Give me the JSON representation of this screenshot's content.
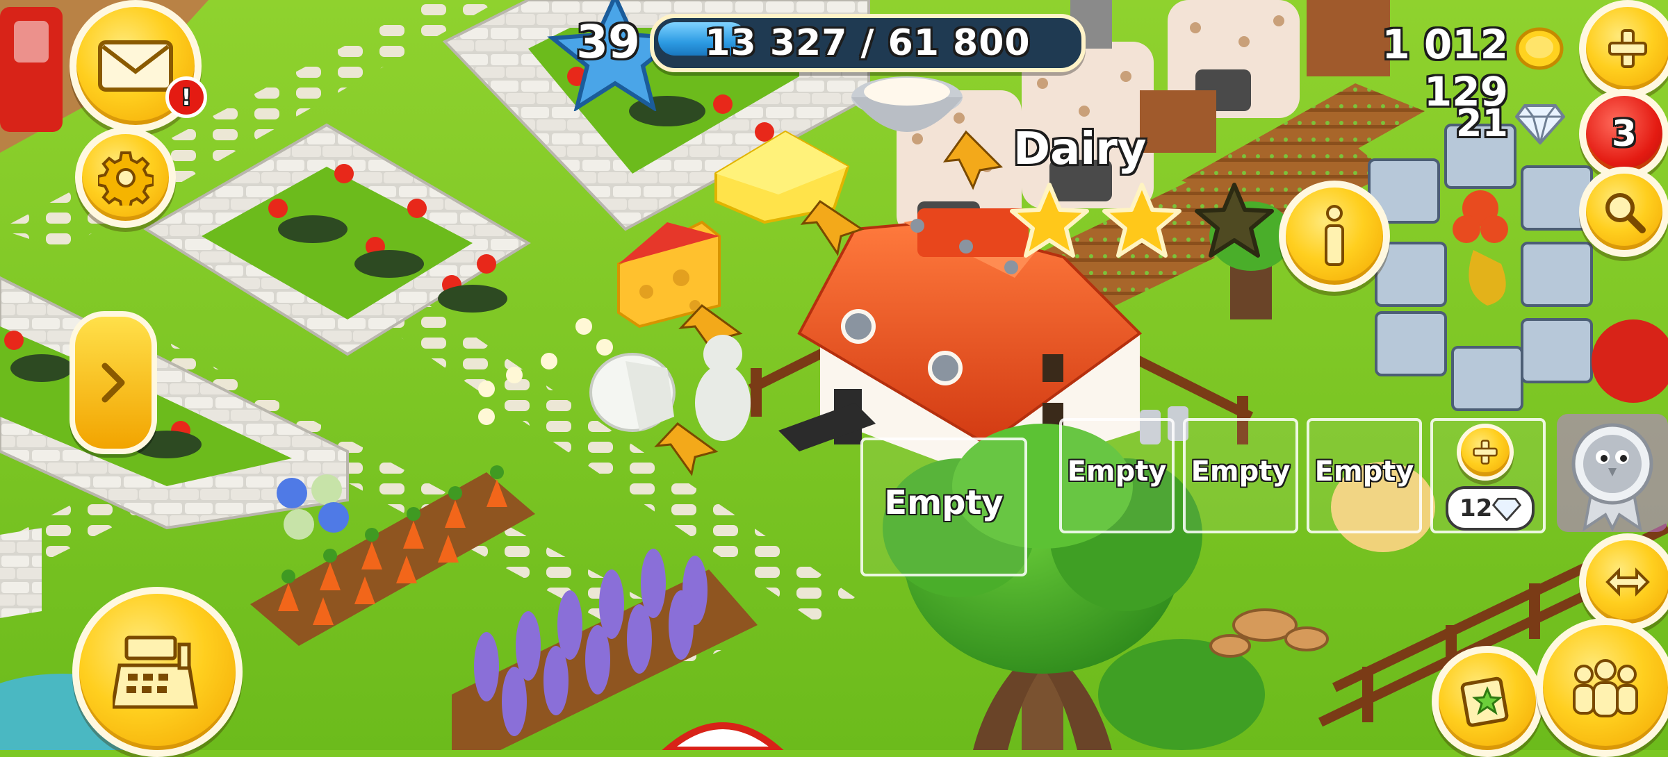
{
  "hud": {
    "level": "39",
    "xp_text": "13 327 / 61 800",
    "xp_progress": 0.216,
    "coins": "1 012 129",
    "diamonds": "21",
    "notification_count": "3",
    "mail_alert": "!"
  },
  "building": {
    "title": "Dairy",
    "stars_earned": 2,
    "stars_total": 3,
    "queue_slots": [
      {
        "label": "Empty"
      },
      {
        "label": "Empty"
      },
      {
        "label": "Empty"
      },
      {
        "label": "Empty"
      }
    ],
    "add_slot_cost": "12",
    "products": [
      "butter",
      "cheese",
      "cream",
      "goat cheese"
    ]
  },
  "icons": {
    "mail": "mail-icon",
    "settings": "gear-icon",
    "expand": "chevron-right-icon",
    "shop": "cash-register-icon",
    "add_coins": "plus-icon",
    "search": "magnifier-icon",
    "info": "info-icon",
    "friends": "friends-icon",
    "newspaper": "newspaper-icon",
    "edit": "edit-arrows-icon",
    "profile": "chicken-badge-icon"
  },
  "colors": {
    "grass": "#7cc824",
    "button_yellow": "#ffcf1f",
    "button_red": "#e41b12",
    "xp_blue": "#2d9be3",
    "star_gold": "#ffc81a",
    "barn_roof": "#e8461c"
  }
}
